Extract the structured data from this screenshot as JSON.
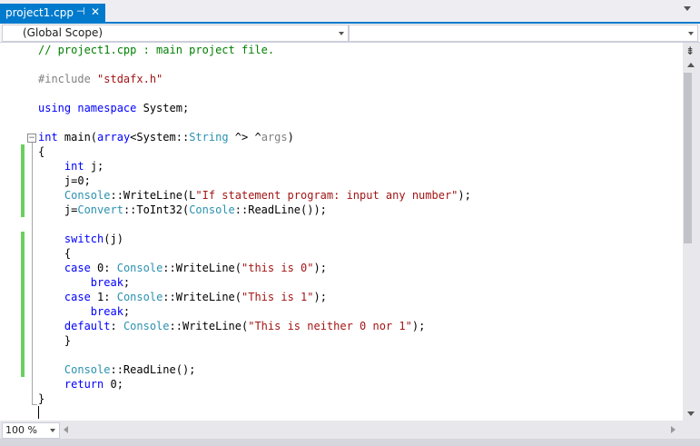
{
  "tab": {
    "title": "project1.cpp",
    "pin_glyph": "⊣",
    "close_glyph": "✕"
  },
  "navbar": {
    "scope": "(Global Scope)",
    "member": ""
  },
  "code_lines": [
    [
      {
        "t": "// project1.cpp : main project file.",
        "c": "cm"
      }
    ],
    [],
    [
      {
        "t": "#include ",
        "c": "pp"
      },
      {
        "t": "\"stdafx.h\"",
        "c": "st"
      }
    ],
    [],
    [
      {
        "t": "using namespace",
        "c": "kw"
      },
      {
        "t": " System;"
      }
    ],
    [],
    [
      {
        "t": "int",
        "c": "kw"
      },
      {
        "t": " main("
      },
      {
        "t": "array",
        "c": "kw"
      },
      {
        "t": "<System::"
      },
      {
        "t": "String",
        "c": "ty"
      },
      {
        "t": " ^> ^"
      },
      {
        "t": "args",
        "c": "pp"
      },
      {
        "t": ")"
      }
    ],
    [
      {
        "t": "{"
      }
    ],
    [
      {
        "t": "    "
      },
      {
        "t": "int",
        "c": "kw"
      },
      {
        "t": " j;"
      }
    ],
    [
      {
        "t": "    j=0;"
      }
    ],
    [
      {
        "t": "    "
      },
      {
        "t": "Console",
        "c": "ty"
      },
      {
        "t": "::WriteLine(L"
      },
      {
        "t": "\"If statement program: input any number\"",
        "c": "st"
      },
      {
        "t": ");"
      }
    ],
    [
      {
        "t": "    j="
      },
      {
        "t": "Convert",
        "c": "ty"
      },
      {
        "t": "::ToInt32("
      },
      {
        "t": "Console",
        "c": "ty"
      },
      {
        "t": "::ReadLine());"
      }
    ],
    [],
    [
      {
        "t": "    "
      },
      {
        "t": "switch",
        "c": "kw"
      },
      {
        "t": "(j)"
      }
    ],
    [
      {
        "t": "    {"
      }
    ],
    [
      {
        "t": "    "
      },
      {
        "t": "case",
        "c": "kw"
      },
      {
        "t": " 0: "
      },
      {
        "t": "Console",
        "c": "ty"
      },
      {
        "t": "::WriteLine("
      },
      {
        "t": "\"this is 0\"",
        "c": "st"
      },
      {
        "t": ");"
      }
    ],
    [
      {
        "t": "        "
      },
      {
        "t": "break",
        "c": "kw"
      },
      {
        "t": ";"
      }
    ],
    [
      {
        "t": "    "
      },
      {
        "t": "case",
        "c": "kw"
      },
      {
        "t": " 1: "
      },
      {
        "t": "Console",
        "c": "ty"
      },
      {
        "t": "::WriteLine("
      },
      {
        "t": "\"This is 1\"",
        "c": "st"
      },
      {
        "t": ");"
      }
    ],
    [
      {
        "t": "        "
      },
      {
        "t": "break",
        "c": "kw"
      },
      {
        "t": ";"
      }
    ],
    [
      {
        "t": "    "
      },
      {
        "t": "default",
        "c": "kw"
      },
      {
        "t": ": "
      },
      {
        "t": "Console",
        "c": "ty"
      },
      {
        "t": "::WriteLine("
      },
      {
        "t": "\"This is neither 0 nor 1\"",
        "c": "st"
      },
      {
        "t": ");"
      }
    ],
    [
      {
        "t": "    }"
      }
    ],
    [],
    [
      {
        "t": "    "
      },
      {
        "t": "Console",
        "c": "ty"
      },
      {
        "t": "::ReadLine();"
      }
    ],
    [
      {
        "t": "    "
      },
      {
        "t": "return",
        "c": "kw"
      },
      {
        "t": " 0;"
      }
    ],
    [
      {
        "t": "}"
      }
    ]
  ],
  "zoom": "100 %",
  "colors": {
    "accent": "#007acc",
    "changed": "#6bcf5f",
    "keyword": "#0000ff",
    "type": "#2b91af",
    "string": "#a31515",
    "comment": "#008000"
  }
}
